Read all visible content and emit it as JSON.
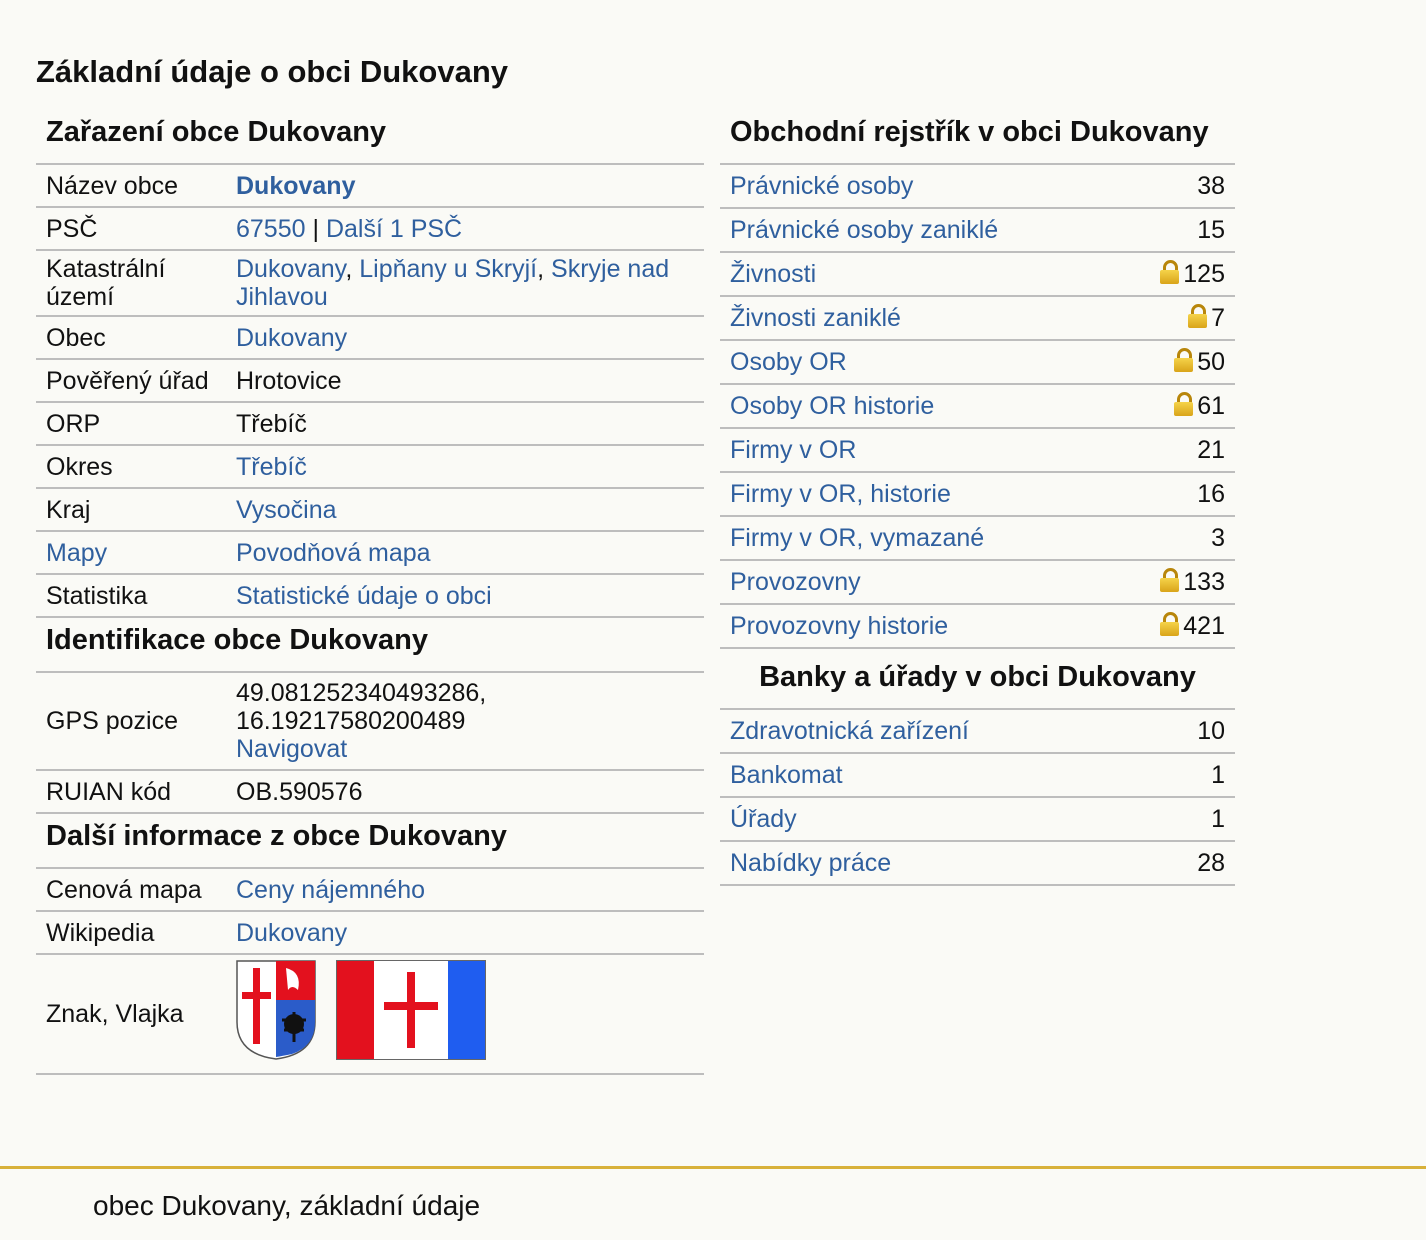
{
  "page_title": "Základní údaje o obci Dukovany",
  "zarazeni": {
    "heading": "Zařazení obce Dukovany",
    "rows": {
      "nazev": {
        "label": "Název obce",
        "value": "Dukovany"
      },
      "psc": {
        "label": "PSČ",
        "value": "67550",
        "sep": "|",
        "more": "Další 1 PSČ"
      },
      "katastr": {
        "label1": "Katastrální",
        "label2": "území",
        "v1": "Dukovany",
        "v2": "Lipňany u Skryjí",
        "v3": "Skryje nad Jihlavou"
      },
      "obec": {
        "label": "Obec",
        "value": "Dukovany"
      },
      "povereny": {
        "label": "Pověřený úřad",
        "value": "Hrotovice"
      },
      "orp": {
        "label": "ORP",
        "value": "Třebíč"
      },
      "okres": {
        "label": "Okres",
        "value": "Třebíč"
      },
      "kraj": {
        "label": "Kraj",
        "value": "Vysočina"
      },
      "mapy": {
        "label": "Mapy",
        "value": "Povodňová mapa"
      },
      "statistika": {
        "label": "Statistika",
        "value": "Statistické údaje o obci"
      }
    }
  },
  "identifikace": {
    "heading": "Identifikace obce Dukovany",
    "gps": {
      "label": "GPS pozice",
      "lat": "49.081252340493286,",
      "lon": "16.19217580200489",
      "link": "Navigovat"
    },
    "ruian": {
      "label": "RUIAN kód",
      "value": "OB.590576"
    }
  },
  "dalsi": {
    "heading": "Další informace z obce Dukovany",
    "cenova": {
      "label": "Cenová mapa",
      "value": "Ceny nájemného"
    },
    "wiki": {
      "label": "Wikipedia",
      "value": "Dukovany"
    },
    "znak": {
      "label": "Znak, Vlajka"
    }
  },
  "obchodni": {
    "heading": "Obchodní rejstřík v obci Dukovany",
    "rows": [
      {
        "label": "Právnické osoby",
        "value": "38",
        "locked": false
      },
      {
        "label": "Právnické osoby zaniklé",
        "value": "15",
        "locked": false
      },
      {
        "label": "Živnosti",
        "value": "125",
        "locked": true
      },
      {
        "label": "Živnosti zaniklé",
        "value": "7",
        "locked": true
      },
      {
        "label": "Osoby OR",
        "value": "50",
        "locked": true
      },
      {
        "label": "Osoby OR historie",
        "value": "61",
        "locked": true
      },
      {
        "label": "Firmy v OR",
        "value": "21",
        "locked": false
      },
      {
        "label": "Firmy v OR, historie",
        "value": "16",
        "locked": false
      },
      {
        "label": "Firmy v OR, vymazané",
        "value": "3",
        "locked": false
      },
      {
        "label": "Provozovny",
        "value": "133",
        "locked": true
      },
      {
        "label": "Provozovny historie",
        "value": "421",
        "locked": true
      }
    ]
  },
  "banky": {
    "heading": "Banky a úřady v obci Dukovany",
    "rows": [
      {
        "label": "Zdravotnická zařízení",
        "value": "10"
      },
      {
        "label": "Bankomat",
        "value": "1"
      },
      {
        "label": "Úřady",
        "value": "1"
      },
      {
        "label": "Nabídky práce",
        "value": "28"
      }
    ]
  },
  "footer": {
    "text": "obec Dukovany, základní údaje"
  },
  "colors": {
    "link": "#2f5f9e",
    "footer_rule": "#d8b13a",
    "background": "#fafaf6"
  }
}
